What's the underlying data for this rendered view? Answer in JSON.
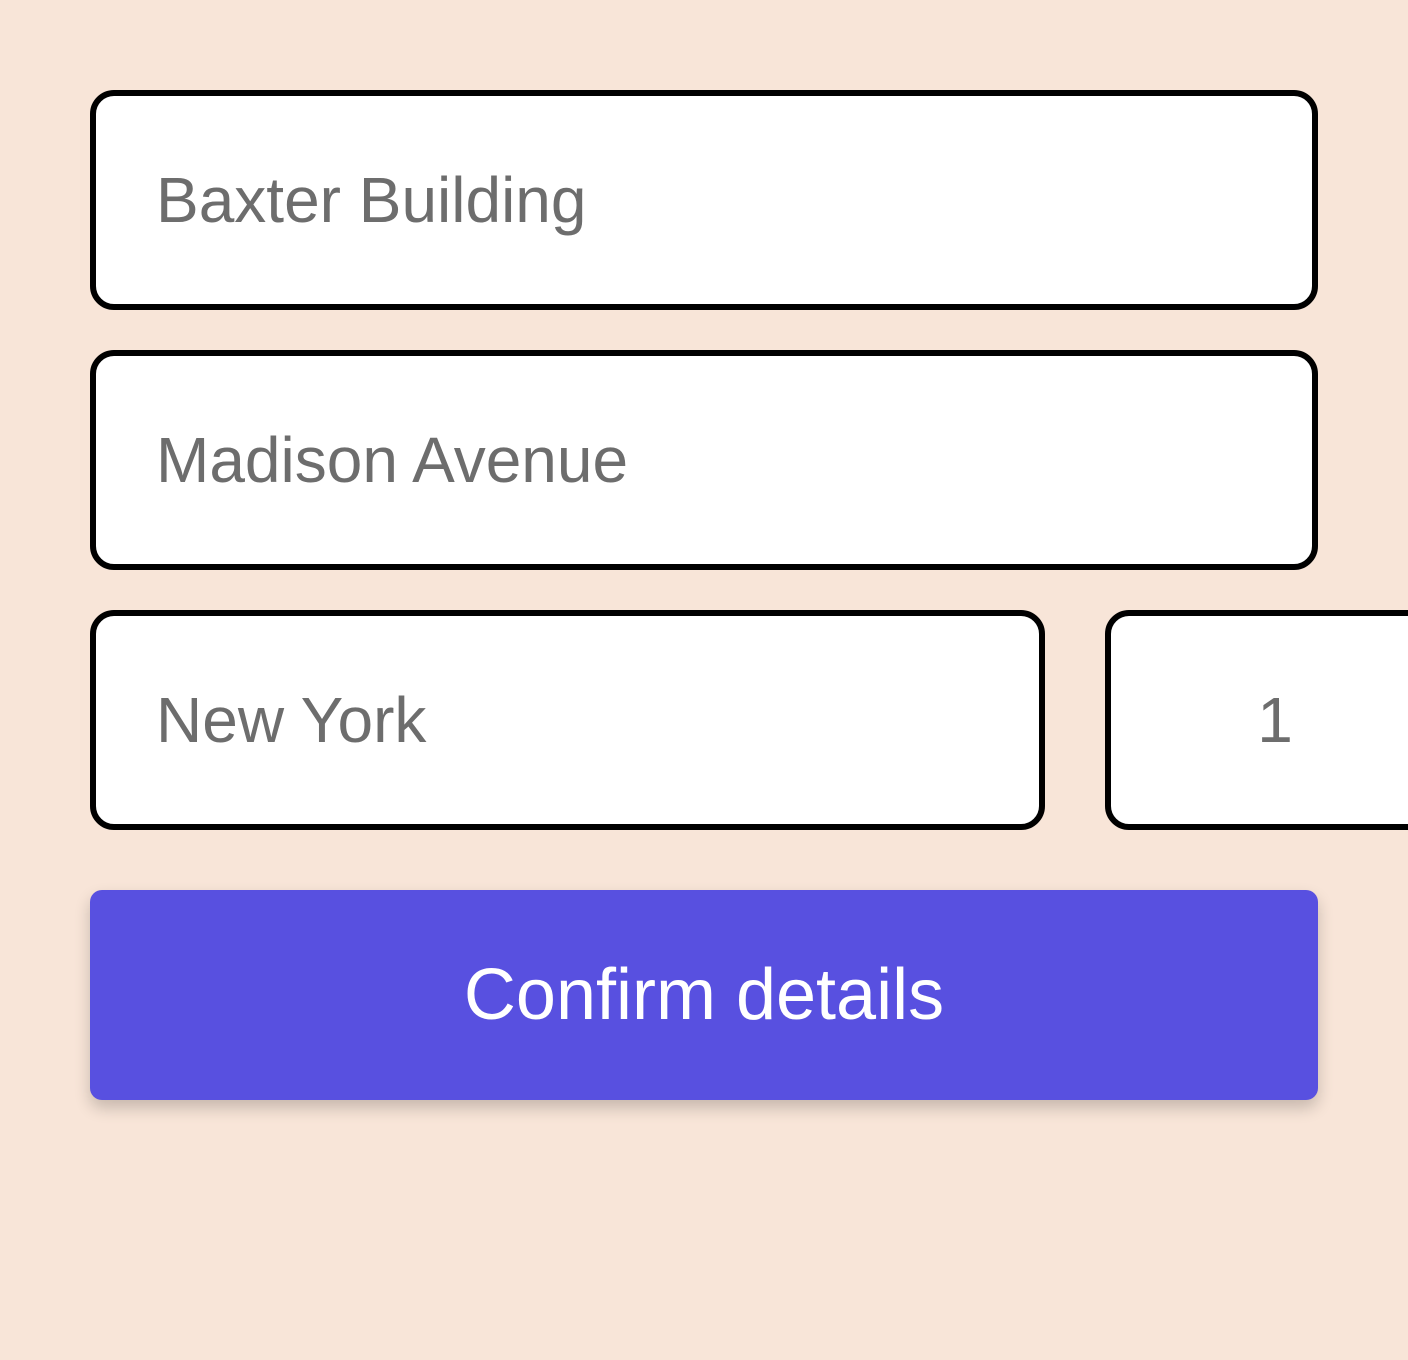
{
  "form": {
    "building": {
      "value": "Baxter Building"
    },
    "street": {
      "value": "Madison Avenue"
    },
    "city": {
      "value": "New York"
    },
    "number": {
      "value": "1"
    },
    "confirm_label": "Confirm details"
  },
  "colors": {
    "background": "#f8e5d8",
    "button": "#5850e0",
    "input_border": "#000000",
    "input_text": "#6d6d6d"
  }
}
